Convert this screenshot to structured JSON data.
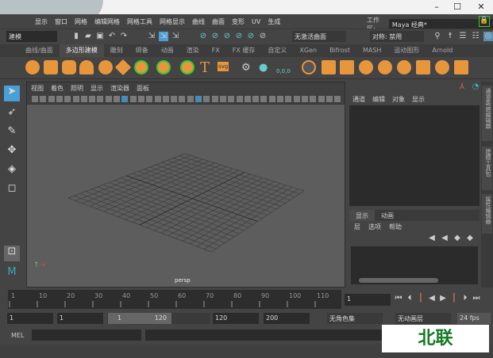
{
  "window": {
    "minimize": "–",
    "maximize": "☐",
    "close": "✕"
  },
  "menubar": {
    "items": [
      "显示",
      "窗口",
      "网格",
      "编辑网格",
      "网格工具",
      "网格显示",
      "曲线",
      "曲面",
      "变形",
      "UV",
      "生成"
    ],
    "workspace_label": "工作区:",
    "workspace_value": "Maya 经典*"
  },
  "status": {
    "mode": "建模",
    "live_surface": "无激活曲面",
    "symmetry": "对称: 禁用"
  },
  "shelf_tabs": [
    {
      "label": "曲线/曲面"
    },
    {
      "label": "多边形建模",
      "active": true
    },
    {
      "label": "雕刻"
    },
    {
      "label": "绑备"
    },
    {
      "label": "动画"
    },
    {
      "label": "渲染"
    },
    {
      "label": "FX"
    },
    {
      "label": "FX 缓存"
    },
    {
      "label": "自定义"
    },
    {
      "label": "XGen"
    },
    {
      "label": "Bifrost"
    },
    {
      "label": "MASH"
    },
    {
      "label": "运动图形"
    },
    {
      "label": "Arnold"
    }
  ],
  "shelf": {
    "text_icon": "T",
    "svg_icon": "svg",
    "coords": "0,0,0"
  },
  "viewport": {
    "menu": [
      "视图",
      "着色",
      "照明",
      "显示",
      "渲染器",
      "面板"
    ],
    "camera": "persp",
    "accent": "#4a9fd6"
  },
  "channel_box": {
    "menu": [
      "通道",
      "编辑",
      "对象",
      "显示"
    ]
  },
  "layer_editor": {
    "tabs": [
      "显示",
      "动画"
    ],
    "menu": [
      "层",
      "选项",
      "帮助"
    ]
  },
  "side_tabs": [
    "通道盒/层编辑器",
    "建模工具包",
    "属性编辑器"
  ],
  "timeline": {
    "ticks": [
      "1",
      "10",
      "20",
      "30",
      "40",
      "50",
      "60",
      "70",
      "80",
      "90",
      "100",
      "110",
      "1"
    ],
    "current_frame": "1"
  },
  "range": {
    "start": "1",
    "playback_start": "1",
    "slider_start": "1",
    "slider_end": "120",
    "playback_end": "120",
    "end": "200",
    "character_set": "无角色集",
    "anim_layer": "无动画层",
    "fps": "24 fps"
  },
  "command": {
    "label": "MEL"
  },
  "watermark": "北联"
}
